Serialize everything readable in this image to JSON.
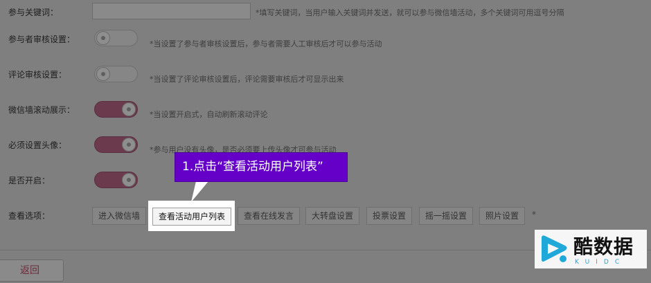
{
  "form": {
    "keyword": {
      "label": "参与关键词：",
      "value": "",
      "hint": "*填写关键词，当用户输入关键词并发送，就可以参与微信墙活动，多个关键词可用逗号分隔"
    },
    "participant_review": {
      "label": "参与者审核设置：",
      "state": "off",
      "hint": "*当设置了参与者审核设置后，参与者需要人工审核后才可以参与活动"
    },
    "comment_review": {
      "label": "评论审核设置：",
      "state": "off",
      "hint": "*当设置了评论审核设置后，评论需要审核后才可显示出来"
    },
    "scroll_display": {
      "label": "微信墙滚动展示：",
      "state": "on",
      "hint": "*当设置开启式，自动刷新滚动评论"
    },
    "require_avatar": {
      "label": "必须设置头像：",
      "state": "on",
      "hint": "*参与用户没有头像，是否必须要上传头像才可参与活动"
    },
    "enabled": {
      "label": "是否开启：",
      "state": "on"
    },
    "options": {
      "label": "查看选项：",
      "buttons": [
        "进入微信墙",
        "查看活动用户列表",
        "查看在线发言",
        "大转盘设置",
        "投票设置",
        "摇一摇设置",
        "照片设置"
      ],
      "star": "*"
    }
  },
  "footer": {
    "back_label": "返回"
  },
  "callout": {
    "text": "1.点击“查看活动用户列表”"
  },
  "watermark": {
    "title": "酷数据",
    "sub": "KUIDC"
  },
  "colors": {
    "callout_bg": "#6400c8",
    "toggle_on": "#6b3a4c",
    "overlay": "#7f7f7f"
  }
}
